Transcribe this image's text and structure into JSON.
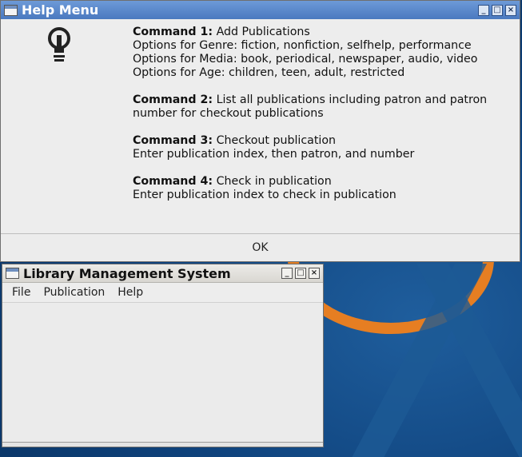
{
  "help_window": {
    "title": "Help Menu",
    "icon": "lightbulb-icon",
    "commands": [
      {
        "heading": "Command 1:",
        "text": "Add Publications",
        "details": [
          "Options for Genre: fiction, nonfiction, selfhelp, performance",
          "Options for Media: book, periodical, newspaper, audio, video",
          "Options for Age: children, teen, adult, restricted"
        ]
      },
      {
        "heading": "Command 2:",
        "text": "List all publications including patron and patron",
        "details": [
          "number for checkout publications"
        ]
      },
      {
        "heading": "Command 3:",
        "text": "Checkout publication",
        "details": [
          "Enter publication index, then patron, and number"
        ]
      },
      {
        "heading": "Command 4:",
        "text": "Check in publication",
        "details": [
          "Enter publication index to check in publication"
        ]
      }
    ],
    "ok_label": "OK"
  },
  "library_window": {
    "title": "Library Management System",
    "menus": [
      "File",
      "Publication",
      "Help"
    ]
  },
  "colors": {
    "active_title": "#4a79bf",
    "desktop": "#0f437d",
    "orange": "#e67e22"
  }
}
